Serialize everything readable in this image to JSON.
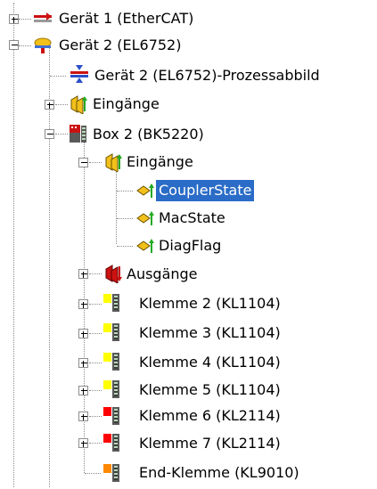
{
  "tree": {
    "items": [
      {
        "label": "Gerät 1 (EtherCAT)",
        "icon": "ethercat-device-icon",
        "toggle": "plus",
        "selected": false
      },
      {
        "label": "Gerät 2 (EL6752)",
        "icon": "canopen-device-icon",
        "toggle": "minus",
        "selected": false
      },
      {
        "label": "Gerät 2 (EL6752)-Prozessabbild",
        "icon": "process-image-icon",
        "toggle": "",
        "selected": false
      },
      {
        "label": "Eingänge",
        "icon": "inputs-icon",
        "toggle": "plus",
        "selected": false
      },
      {
        "label": "Box 2  (BK5220)",
        "icon": "bus-coupler-icon",
        "toggle": "minus",
        "selected": false
      },
      {
        "label": "Eingänge",
        "icon": "inputs-icon",
        "toggle": "minus",
        "selected": false
      },
      {
        "label": "CouplerState",
        "icon": "input-variable-icon",
        "toggle": "",
        "selected": true
      },
      {
        "label": "MacState",
        "icon": "input-variable-icon",
        "toggle": "",
        "selected": false
      },
      {
        "label": "DiagFlag",
        "icon": "input-variable-icon",
        "toggle": "",
        "selected": false
      },
      {
        "label": "Ausgänge",
        "icon": "outputs-icon",
        "toggle": "plus",
        "selected": false
      },
      {
        "label": "Klemme 2 (KL1104)",
        "icon": "terminal-digital-input-icon",
        "toggle": "plus",
        "selected": false,
        "color": "#ffff00"
      },
      {
        "label": "Klemme 3 (KL1104)",
        "icon": "terminal-digital-input-icon",
        "toggle": "plus",
        "selected": false,
        "color": "#ffff00"
      },
      {
        "label": "Klemme 4 (KL1104)",
        "icon": "terminal-digital-input-icon",
        "toggle": "plus",
        "selected": false,
        "color": "#ffff00"
      },
      {
        "label": "Klemme 5 (KL1104)",
        "icon": "terminal-digital-input-icon",
        "toggle": "plus",
        "selected": false,
        "color": "#ffff00"
      },
      {
        "label": "Klemme 6 (KL2114)",
        "icon": "terminal-digital-output-icon",
        "toggle": "plus",
        "selected": false,
        "color": "#ff0000"
      },
      {
        "label": "Klemme 7 (KL2114)",
        "icon": "terminal-digital-output-icon",
        "toggle": "plus",
        "selected": false,
        "color": "#ff0000"
      },
      {
        "label": "End-Klemme (KL9010)",
        "icon": "end-terminal-icon",
        "toggle": "",
        "selected": false,
        "color": "#ff8800"
      }
    ]
  },
  "colors": {
    "selection": "#2a6cc7",
    "input_klemme": "#ffff00",
    "output_klemme": "#ff0000",
    "end_klemme": "#ff8800"
  }
}
